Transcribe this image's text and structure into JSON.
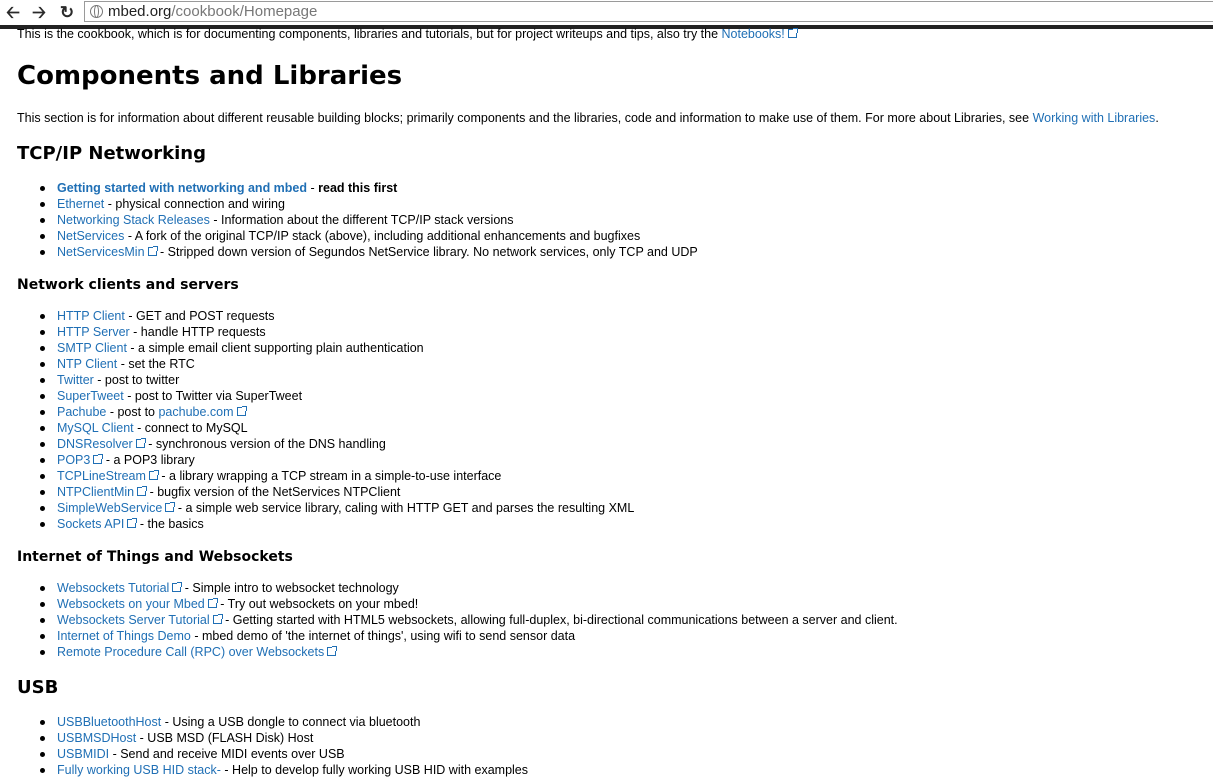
{
  "browser": {
    "back_icon": "back-arrow-icon",
    "forward_icon": "forward-arrow-icon",
    "reload_icon": "reload-icon",
    "url_domain": "mbed.org",
    "url_path": "/cookbook/Homepage"
  },
  "intro": {
    "text": "This is the cookbook, which is for documenting components, libraries and tutorials, but for project writeups and tips, also try the ",
    "link": "Notebooks!"
  },
  "heading": "Components and Libraries",
  "section_intro": {
    "text": "This section is for information about different reusable building blocks; primarily components and the libraries, code and information to make use of them. For more about Libraries, see ",
    "link": "Working with Libraries",
    "tail": "."
  },
  "tcpip": {
    "title": "TCP/IP Networking",
    "items": [
      {
        "link": "Getting started with networking and mbed",
        "desc": " - ",
        "desc_bold": "read this first",
        "ext": false,
        "bold_link": true
      },
      {
        "link": "Ethernet",
        "desc": " - physical connection and wiring",
        "ext": false
      },
      {
        "link": "Networking Stack Releases",
        "desc": " - Information about the different TCP/IP stack versions",
        "ext": false
      },
      {
        "link": "NetServices",
        "desc": " - A fork of the original TCP/IP stack (above), including additional enhancements and bugfixes",
        "ext": false
      },
      {
        "link": "NetServicesMin",
        "desc": " - Stripped down version of Segundos NetService library. No network services, only TCP and UDP",
        "ext": true
      }
    ]
  },
  "clients": {
    "title": "Network clients and servers",
    "items": [
      {
        "link": "HTTP Client",
        "desc": " - GET and POST requests",
        "ext": false
      },
      {
        "link": "HTTP Server",
        "desc": " - handle HTTP requests",
        "ext": false
      },
      {
        "link": "SMTP Client",
        "desc": " - a simple email client supporting plain authentication",
        "ext": false
      },
      {
        "link": "NTP Client",
        "desc": " - set the RTC",
        "ext": false
      },
      {
        "link": "Twitter",
        "desc": " - post to twitter",
        "ext": false
      },
      {
        "link": "SuperTweet",
        "desc": " - post to Twitter via SuperTweet",
        "ext": false
      },
      {
        "link": "Pachube",
        "desc": " - post to ",
        "link2": "pachube.com",
        "ext": false,
        "ext2": true
      },
      {
        "link": "MySQL Client",
        "desc": " - connect to MySQL",
        "ext": false
      },
      {
        "link": "DNSResolver",
        "desc": " - synchronous version of the DNS handling",
        "ext": true
      },
      {
        "link": "POP3",
        "desc": " - a POP3 library",
        "ext": true
      },
      {
        "link": "TCPLineStream",
        "desc": " - a library wrapping a TCP stream in a simple-to-use interface",
        "ext": true
      },
      {
        "link": "NTPClientMin",
        "desc": " - bugfix version of the NetServices NTPClient",
        "ext": true
      },
      {
        "link": "SimpleWebService",
        "desc": " - a simple web service library, caling with HTTP GET and parses the resulting XML",
        "ext": true
      },
      {
        "link": "Sockets API",
        "desc": " - the basics",
        "ext": true
      }
    ]
  },
  "iot": {
    "title": "Internet of Things and Websockets",
    "items": [
      {
        "link": "Websockets Tutorial",
        "desc": " - Simple intro to websocket technology",
        "ext": true
      },
      {
        "link": "Websockets on your Mbed",
        "desc": " - Try out websockets on your mbed!",
        "ext": true
      },
      {
        "link": "Websockets Server Tutorial",
        "desc": " - Getting started with HTML5 websockets, allowing full-duplex, bi-directional communications between a server and client.",
        "ext": true
      },
      {
        "link": "Internet of Things Demo",
        "desc": " - mbed demo of 'the internet of things', using wifi to send sensor data",
        "ext": false
      },
      {
        "link": "Remote Procedure Call (RPC) over Websockets",
        "desc": "",
        "ext": true
      }
    ]
  },
  "usb": {
    "title": "USB",
    "items": [
      {
        "link": "USBBluetoothHost",
        "desc": " - Using a USB dongle to connect via bluetooth",
        "ext": false
      },
      {
        "link": "USBMSDHost",
        "desc": " - USB MSD (FLASH Disk) Host",
        "ext": false
      },
      {
        "link": "USBMIDI",
        "desc": " - Send and receive MIDI events over USB",
        "ext": false
      },
      {
        "link": "Fully working USB HID stack-",
        "desc": " - Help to develop fully working USB HID with examples",
        "ext": false
      }
    ]
  }
}
